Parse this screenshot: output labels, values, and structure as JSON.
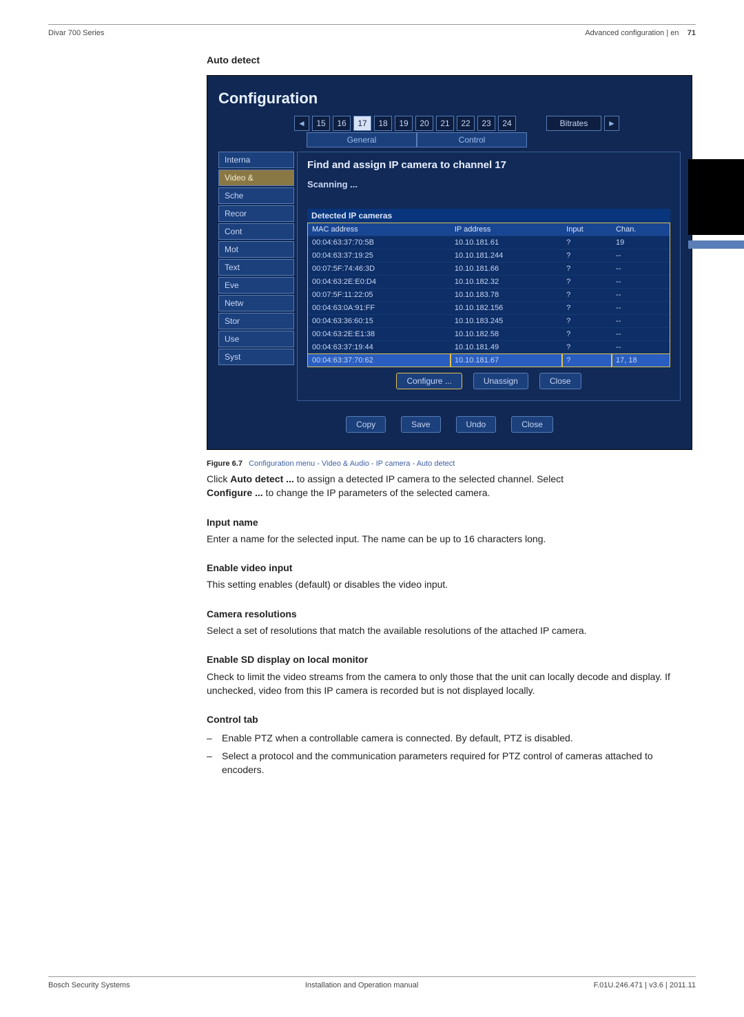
{
  "page": {
    "header_left": "Divar 700 Series",
    "header_right_section": "Advanced configuration | en",
    "header_right_page": "71",
    "heading_auto_detect": "Auto detect",
    "figure_label": "Figure 6.7",
    "figure_caption": "Configuration menu - Video & Audio - IP camera - Auto detect",
    "after_fig_line1a": "Click ",
    "after_fig_line1b": "Auto detect ...",
    "after_fig_line1c": " to assign a detected IP camera to the selected channel. Select ",
    "after_fig_line2a": "Configure ...",
    "after_fig_line2b": " to change the IP parameters of the selected camera.",
    "s1_h": "Input name",
    "s1_p": "Enter a name for the selected input. The name can be up to 16 characters long.",
    "s2_h": "Enable video input",
    "s2_p": "This setting enables (default) or disables the video input.",
    "s3_h": "Camera resolutions",
    "s3_p": "Select a set of resolutions that match the available resolutions of the attached IP camera.",
    "s4_h": "Enable SD display on local monitor",
    "s4_p": "Check to limit the video streams from the camera to only those that the unit can locally decode and display. If unchecked, video from this IP camera is recorded but is not displayed locally.",
    "s5_h": "Control tab",
    "s5_li1": "Enable PTZ when a controllable camera is connected. By default, PTZ is disabled.",
    "s5_li2": "Select a protocol and the communication parameters required for PTZ control of cameras attached to encoders.",
    "footer_left": "Bosch Security Systems",
    "footer_center": "Installation and Operation manual",
    "footer_right": "F.01U.246.471 | v3.6 | 2011.11"
  },
  "ui": {
    "title": "Configuration",
    "tabs": [
      "15",
      "16",
      "17",
      "18",
      "19",
      "20",
      "21",
      "22",
      "23",
      "24"
    ],
    "tab_selected": "17",
    "bitrates": "Bitrates",
    "subtab1": "General",
    "subtab2": "Control",
    "side": [
      "Interna",
      "Video &",
      "Sche",
      "Recor",
      "Cont",
      "Mot",
      "Text",
      "Eve",
      "Netw",
      "Stor",
      "Use",
      "Syst"
    ],
    "modal_title": "Find and assign IP camera to channel 17",
    "scanning": "Scanning ...",
    "section": "Detected IP cameras",
    "th": {
      "mac": "MAC address",
      "ip": "IP address",
      "input": "Input",
      "chan": "Chan."
    },
    "rows": [
      {
        "mac": "00:04:63:37:70:5B",
        "ip": "10.10.181.61",
        "in": "?",
        "ch": "19"
      },
      {
        "mac": "00:04:63:37:19:25",
        "ip": "10.10.181.244",
        "in": "?",
        "ch": "--"
      },
      {
        "mac": "00:07:5F:74:46:3D",
        "ip": "10.10.181.66",
        "in": "?",
        "ch": "--"
      },
      {
        "mac": "00:04:63:2E:E0:D4",
        "ip": "10.10.182.32",
        "in": "?",
        "ch": "--"
      },
      {
        "mac": "00:07:5F:11:22:05",
        "ip": "10.10.183.78",
        "in": "?",
        "ch": "--"
      },
      {
        "mac": "00:04:63:0A:91:FF",
        "ip": "10.10.182.156",
        "in": "?",
        "ch": "--"
      },
      {
        "mac": "00:04:63:36:60:15",
        "ip": "10.10.183.245",
        "in": "?",
        "ch": "--"
      },
      {
        "mac": "00:04:63:2E:E1:38",
        "ip": "10.10.182.58",
        "in": "?",
        "ch": "--"
      },
      {
        "mac": "00:04:63:37:19:44",
        "ip": "10.10.181.49",
        "in": "?",
        "ch": "--"
      },
      {
        "mac": "00:04:63:37:70:62",
        "ip": "10.10.181.67",
        "in": "?",
        "ch": "17, 18"
      }
    ],
    "btn_configure": "Configure ...",
    "btn_unassign": "Unassign",
    "btn_close": "Close",
    "btn_copy": "Copy",
    "btn_save": "Save",
    "btn_undo": "Undo",
    "btn_close2": "Close"
  }
}
